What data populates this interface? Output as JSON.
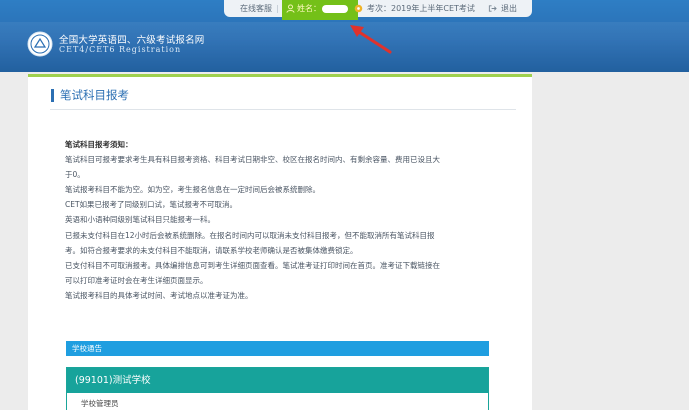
{
  "topbar": {
    "online_service": "在线客服",
    "separator": "|",
    "name_label": "姓名：",
    "name_value": "",
    "exam_label": "考次：2019年上半年CET考试",
    "logout": "退出"
  },
  "site": {
    "title": "全国大学英语四、六级考试报名网",
    "subtitle": "CET4/CET6  Registration"
  },
  "page": {
    "section_title": "笔试科目报考"
  },
  "notice": {
    "heading": "笔试科目报考须知：",
    "lines": [
      "笔试科目可报考要求考生具有科目报考资格、科目考试日期非空、校区在报名时间内、有剩余容量、费用已设且大",
      "于0。",
      "笔试报考科目不能为空。如为空，考生报名信息在一定时间后会被系统删除。",
      "CET如果已报考了同级别口试，笔试报考不可取消。",
      "英语和小语种同级别笔试科目只能报考一科。",
      "已报未支付科目在12小时后会被系统删除。在报名时间内可以取消未支付科目报考，但不能取消所有笔试科目报",
      "考。如符合报考要求的未支付科目不能取消，请联系学校老师确认是否被集体缴费锁定。",
      "已支付科目不可取消报考。具体编排信息可到考生详细页面查看。笔试准考证打印时间在首页。准考证下载链接在",
      "可以打印准考证时会在考生详细页面显示。",
      "笔试报考科目的具体考试时间、考试地点以准考证为准。"
    ]
  },
  "school": {
    "bar_label": "学校通告",
    "name": "(99101)测试学校",
    "admin": "学校管理员"
  },
  "colors": {
    "header_blue": "#2a6eb3",
    "highlight_green": "#74c018",
    "bar_blue": "#1f9ee0",
    "card_teal": "#17a39b",
    "arrow_red": "#e0322c"
  }
}
